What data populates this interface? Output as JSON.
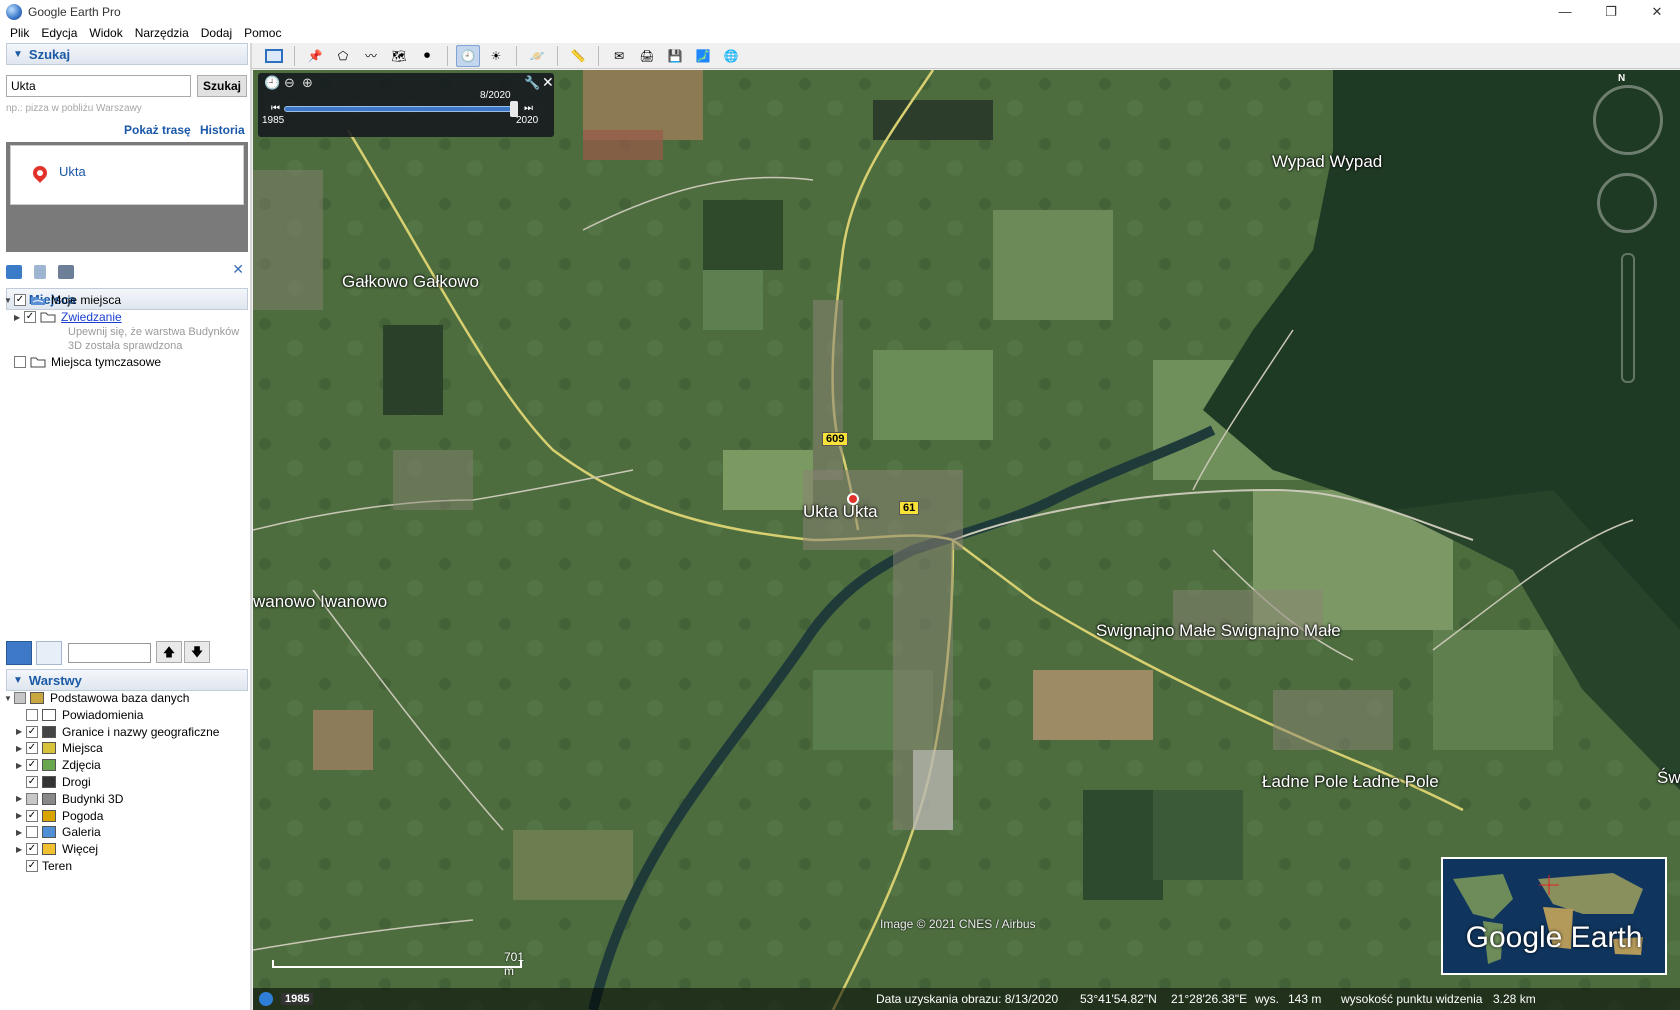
{
  "window": {
    "title": "Google Earth Pro",
    "min": "—",
    "max": "❐",
    "close": "✕"
  },
  "menu": [
    "Plik",
    "Edycja",
    "Widok",
    "Narzędzia",
    "Dodaj",
    "Pomoc"
  ],
  "search": {
    "header": "Szukaj",
    "value": "Ukta",
    "button": "Szukaj",
    "hint": "np.: pizza w pobliżu Warszawy",
    "route": "Pokaż trasę",
    "history": "Historia",
    "result": "Ukta"
  },
  "places": {
    "header": "Miejsca",
    "my_places": "Moje miejsca",
    "tour": "Zwiedzanie",
    "tour_desc_1": "Upewnij się, że warstwa Budynków",
    "tour_desc_2": "3D została sprawdzona",
    "temp": "Miejsca tymczasowe"
  },
  "layers": {
    "header": "Warstwy",
    "items": [
      {
        "label": "Podstawowa baza danych",
        "checked": "grey",
        "exp": "▼"
      },
      {
        "label": "Powiadomienia",
        "checked": "",
        "exp": ""
      },
      {
        "label": "Granice i nazwy geograficzne",
        "checked": "✓",
        "exp": "▶"
      },
      {
        "label": "Miejsca",
        "checked": "✓",
        "exp": "▶"
      },
      {
        "label": "Zdjęcia",
        "checked": "✓",
        "exp": "▶"
      },
      {
        "label": "Drogi",
        "checked": "✓",
        "exp": ""
      },
      {
        "label": "Budynki 3D",
        "checked": "grey",
        "exp": "▶"
      },
      {
        "label": "Pogoda",
        "checked": "✓",
        "exp": "▶"
      },
      {
        "label": "Galeria",
        "checked": "",
        "exp": "▶"
      },
      {
        "label": "Więcej",
        "checked": "✓",
        "exp": "▶"
      },
      {
        "label": "Teren",
        "checked": "✓",
        "exp": ""
      }
    ]
  },
  "timeslider": {
    "current": "8/2020",
    "start": "1985",
    "end": "2020"
  },
  "map_labels": {
    "galkowo": "Gałkowo  Gałkowo",
    "wypad": "Wypad  Wypad",
    "ukta": "Ukta  Ukta",
    "iwanowo": "wanowo  Iwanowo",
    "swignajno": "Swignajno Małe  Swignajno Małe",
    "ladne": "Ładne Pole  Ładne Pole",
    "sw": "Św",
    "road1": "609",
    "road2": "61"
  },
  "copyright": "Image © 2021 CNES / Airbus",
  "scale": "701 m",
  "overview_label": "Google Earth",
  "status": {
    "year": "1985",
    "date": "Data uzyskania obrazu: 8/13/2020",
    "lat": "53°41'54.82\"N",
    "lon": "21°28'26.38\"E",
    "elev_label": "wys.",
    "elev": "143 m",
    "eye_label": "wysokość punktu widzenia",
    "eye": "3.28 km"
  },
  "compass": {
    "north": "N"
  }
}
